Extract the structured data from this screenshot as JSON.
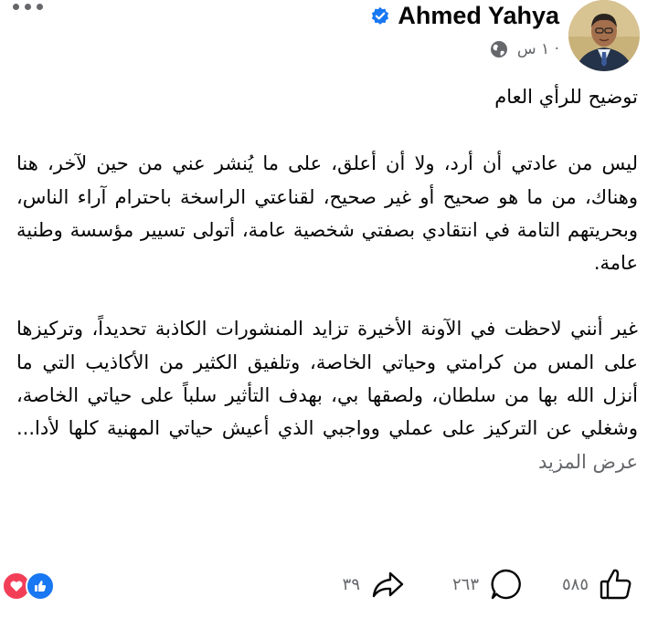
{
  "post": {
    "author": "Ahmed Yahya",
    "time": "١ س ·",
    "title": "توضيح للرأي العام",
    "paragraph1": "ليس من عادتي أن أرد، ولا أن أعلق، على ما يُنشر عني من حين لآخر، هنا وهناك، من ما هو صحيح أو غير صحيح، لقناعتي الراسخة باحترام آراء الناس، وبحريتهم التامة في انتقادي بصفتي شخصية عامة، أتولى تسيير مؤسسة وطنية عامة.",
    "paragraph2": "غير أنني لاحظت في الآونة الأخيرة تزايد المنشورات الكاذبة تحديداً، وتركيزها على المس من كرامتي وحياتي الخاصة، وتلفيق الكثير من الأكاذيب التي ما أنزل الله بها من سلطان، ولصقها بي، بهدف التأثير سلباً على حياتي الخاصة، وشغلي عن التركيز على عملي وواجبي الذي أعيش حياتي المهنية كلها لأدا...",
    "see_more": "عرض المزيد"
  },
  "stats": {
    "likes": "٥٨٥",
    "comments": "٢٦٣",
    "shares": "٣٩"
  },
  "icons": {
    "more": "more-options-icon",
    "verified": "verified-badge-icon",
    "globe": "globe-icon",
    "like": "like-icon",
    "comment": "comment-icon",
    "share": "share-icon",
    "reaction_love": "love-reaction-icon",
    "reaction_like": "like-reaction-icon"
  },
  "colors": {
    "accent": "#1877f2",
    "love": "#f33e58",
    "muted": "#65676b",
    "text": "#050505"
  }
}
